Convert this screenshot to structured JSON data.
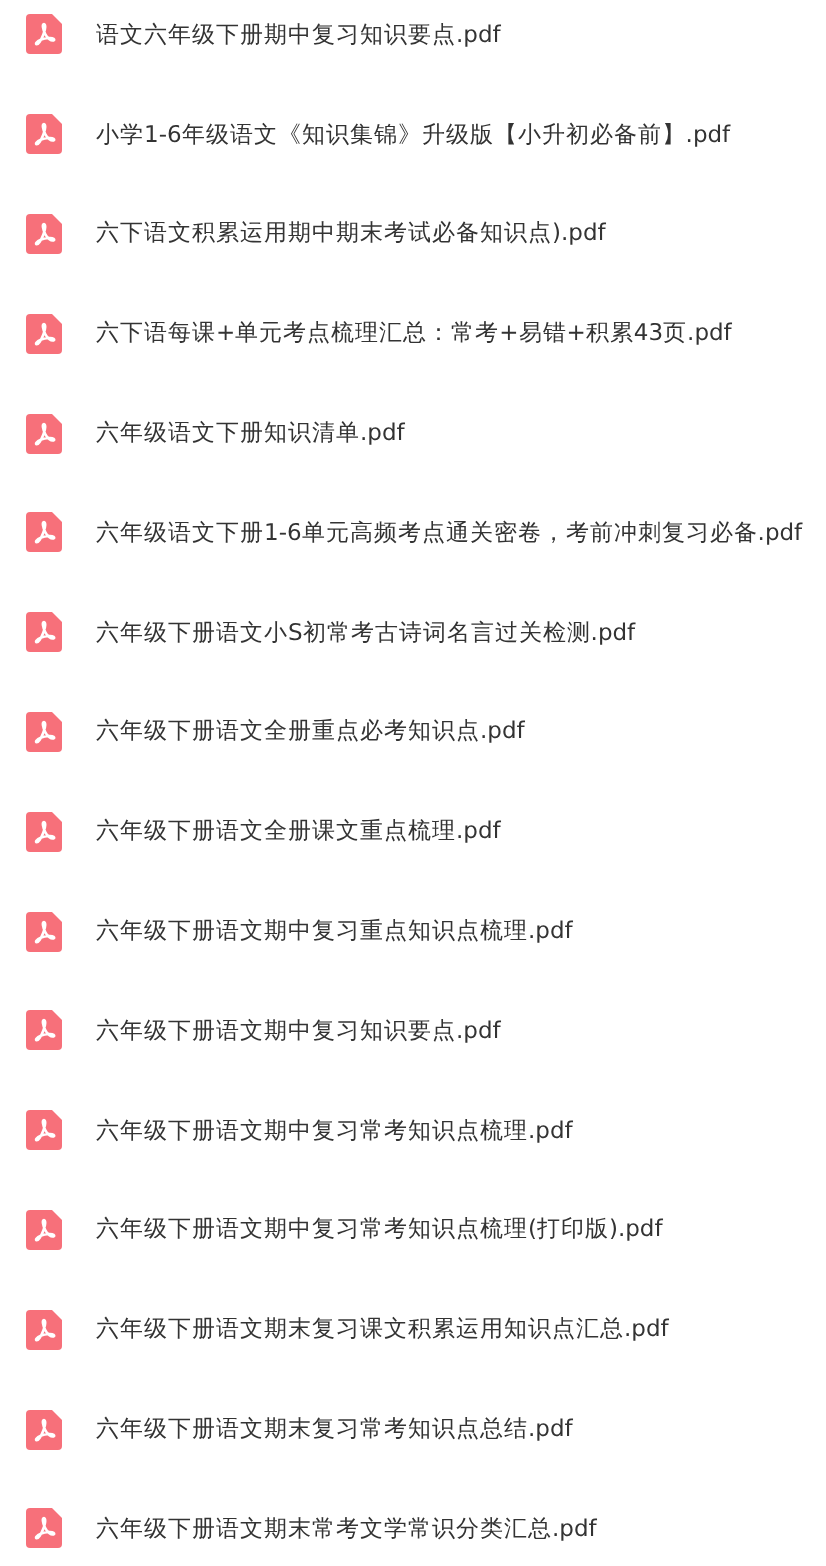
{
  "files": [
    {
      "name": "语文六年级下册期中复习知识要点.pdf"
    },
    {
      "name": "小学1-6年级语文《知识集锦》升级版【小升初必备前】.pdf"
    },
    {
      "name": "六下语文积累运用期中期末考试必备知识点).pdf"
    },
    {
      "name": "六下语每课+单元考点梳理汇总：常考+易错+积累43页.pdf"
    },
    {
      "name": "六年级语文下册知识清单.pdf"
    },
    {
      "name": "六年级语文下册1-6单元高频考点通关密卷，考前冲刺复习必备.pdf"
    },
    {
      "name": "六年级下册语文小S初常考古诗词名言过关检测.pdf"
    },
    {
      "name": "六年级下册语文全册重点必考知识点.pdf"
    },
    {
      "name": "六年级下册语文全册课文重点梳理.pdf"
    },
    {
      "name": "六年级下册语文期中复习重点知识点梳理.pdf"
    },
    {
      "name": "六年级下册语文期中复习知识要点.pdf"
    },
    {
      "name": "六年级下册语文期中复习常考知识点梳理.pdf"
    },
    {
      "name": "六年级下册语文期中复习常考知识点梳理(打印版).pdf"
    },
    {
      "name": "六年级下册语文期末复习课文积累运用知识点汇总.pdf"
    },
    {
      "name": "六年级下册语文期末复习常考知识点总结.pdf"
    },
    {
      "name": "六年级下册语文期末常考文学常识分类汇总.pdf"
    }
  ]
}
